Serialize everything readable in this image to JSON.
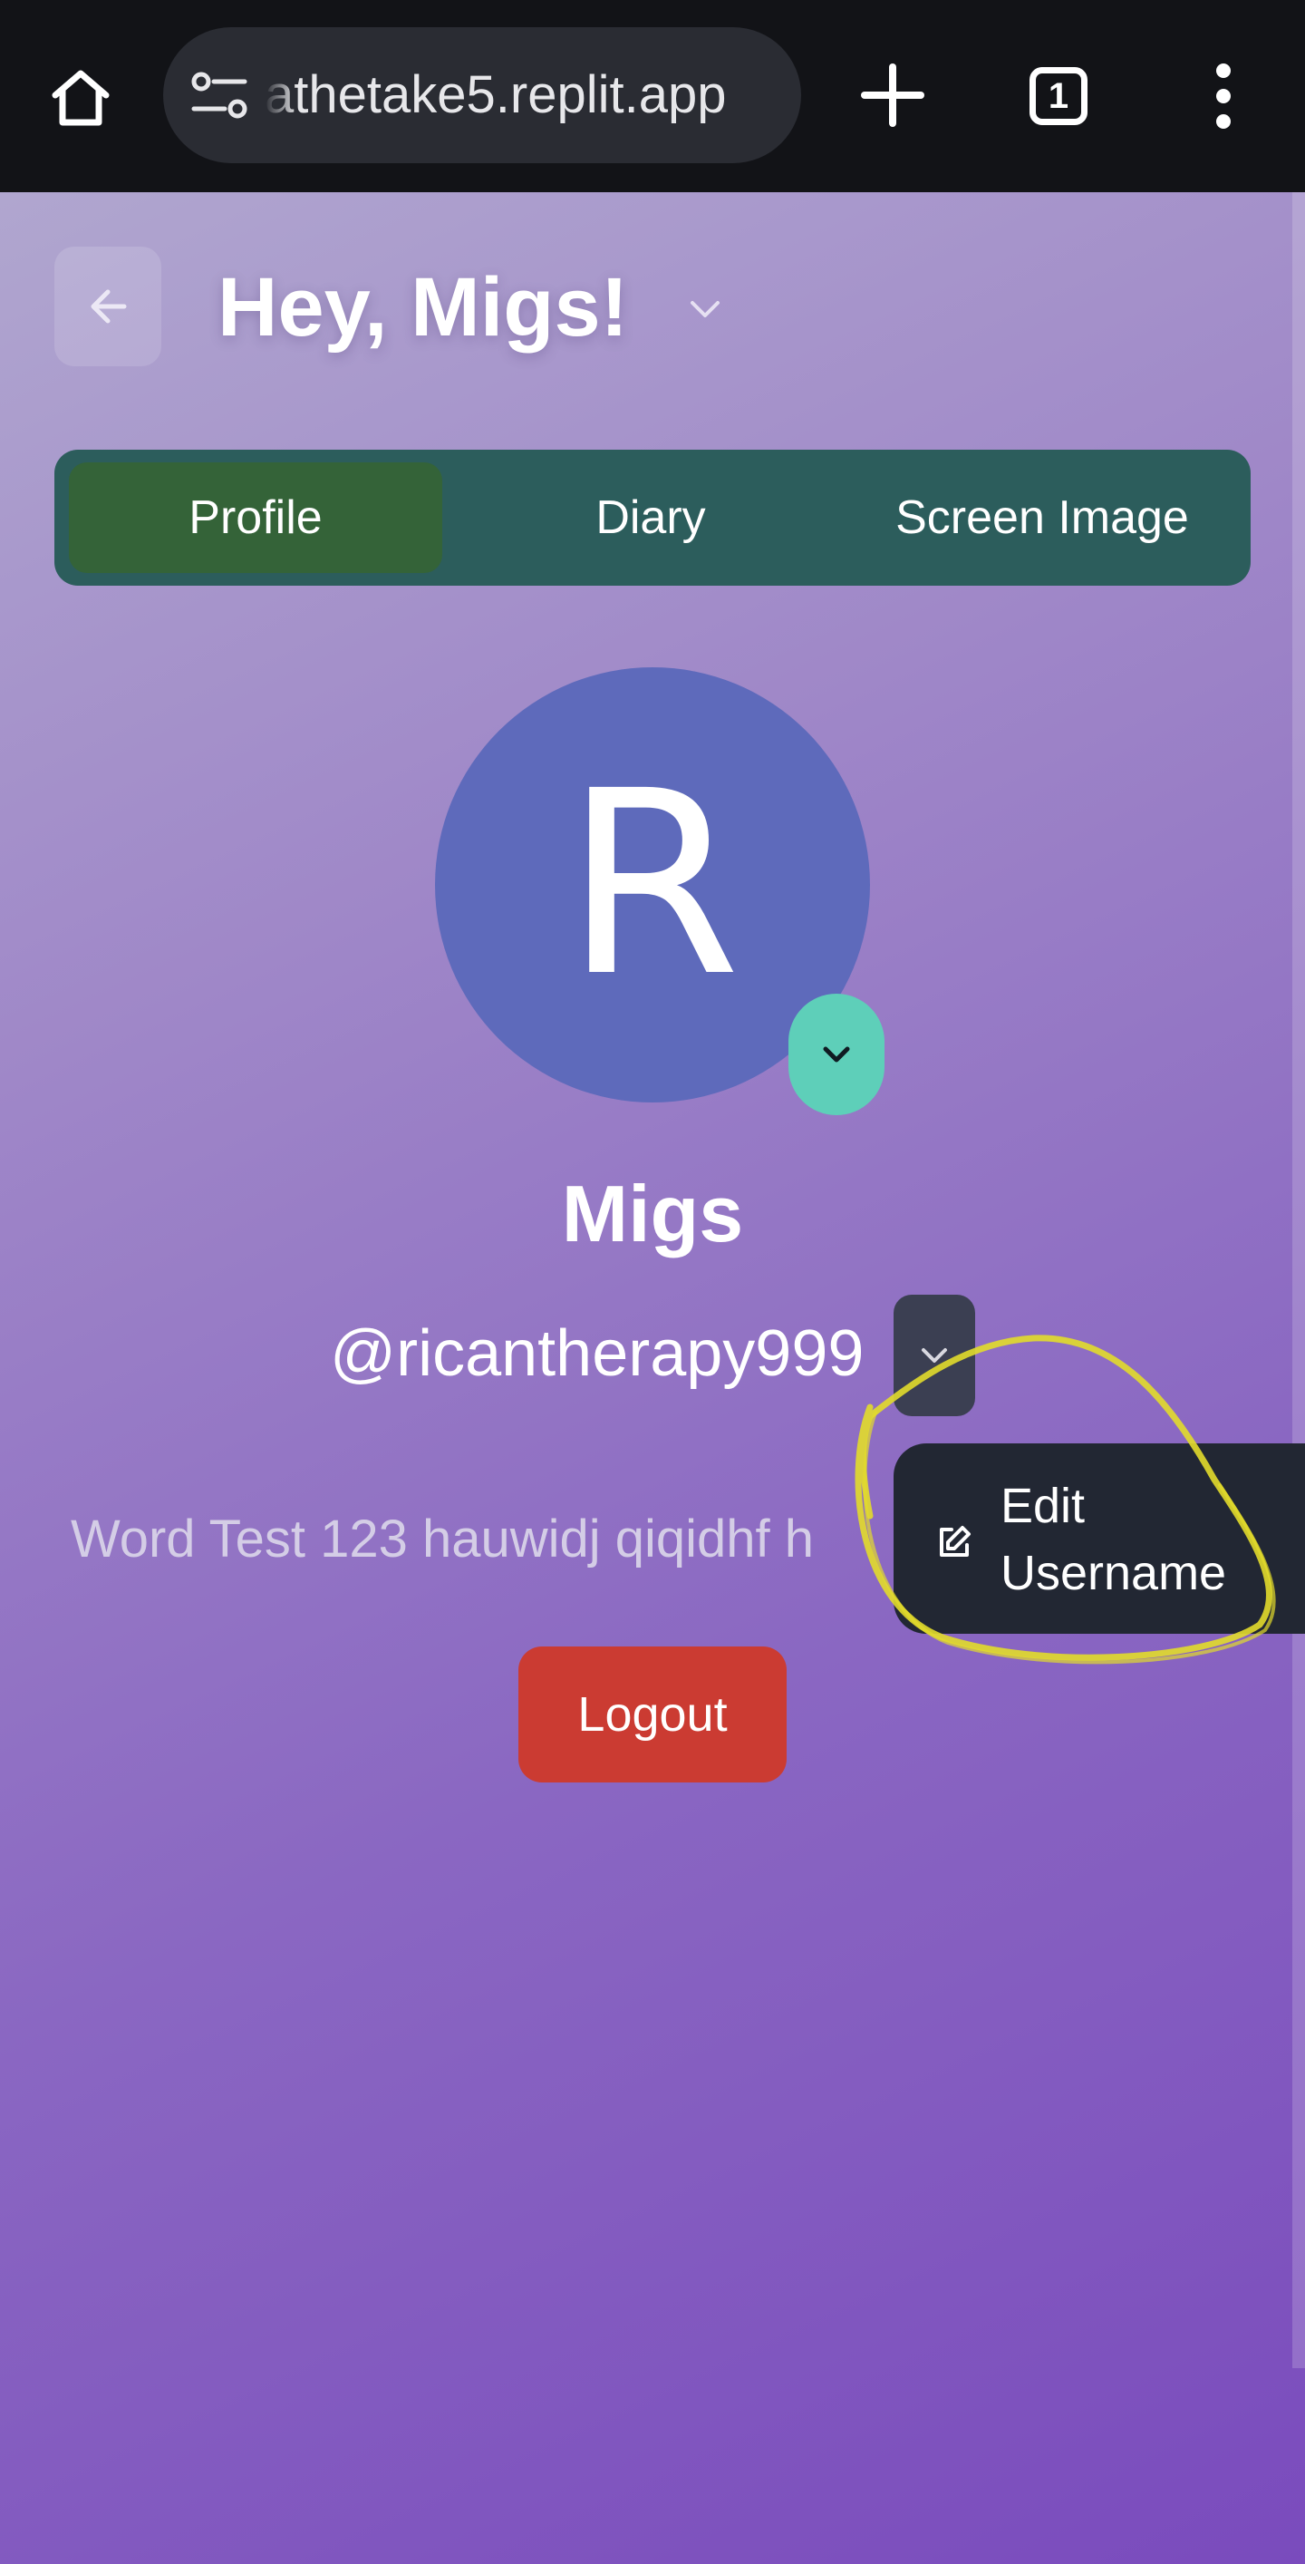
{
  "browser": {
    "url": "athetake5.replit.app",
    "tab_count": "1",
    "icons": [
      "home-icon",
      "site-settings-icon",
      "plus-icon",
      "tab-counter-icon",
      "more-vertical-icon"
    ]
  },
  "header": {
    "greeting": "Hey, Migs!",
    "icons": [
      "arrow-left-icon",
      "chevron-down-icon"
    ]
  },
  "tabs": [
    {
      "label": "Profile",
      "active": true
    },
    {
      "label": "Diary",
      "active": false
    },
    {
      "label": "Screen Image",
      "active": false
    }
  ],
  "profile": {
    "avatar_initial": "R",
    "display_name": "Migs",
    "username": "@ricantherapy999",
    "bio": "Word Test 123 hauwidj qiqidhf h",
    "logout_label": "Logout"
  },
  "username_menu": {
    "items": [
      {
        "label": "Edit Username",
        "icon": "pencil-square-icon"
      }
    ]
  },
  "colors": {
    "browser_bar": "#121317",
    "tab_bar": "#2c5d5c",
    "tab_active": "#346338",
    "avatar": "#5e6abb",
    "avatar_toggle": "#5ecfb9",
    "logout": "#cb3b32",
    "menu": "#222733",
    "annotation_highlight": "#e2dc2b"
  }
}
